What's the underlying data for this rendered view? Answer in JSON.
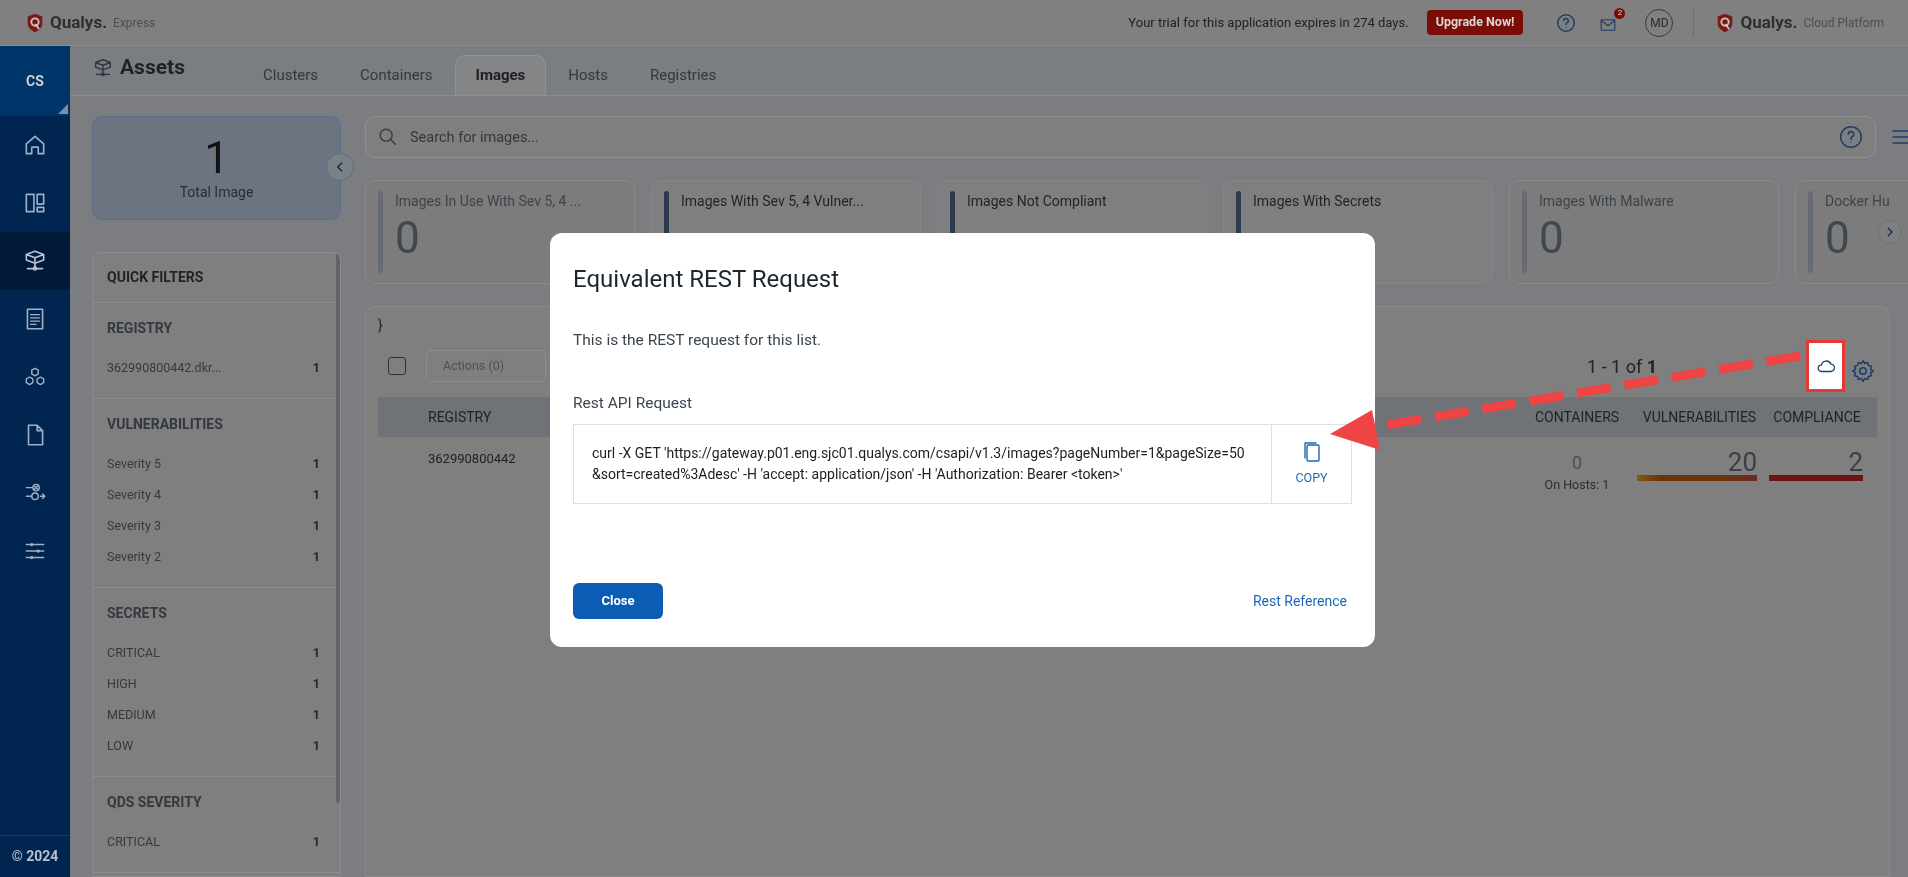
{
  "header": {
    "brand": "Qualys.",
    "product": "Express",
    "trial_notice": "Your trial for this application expires in 274 days.",
    "upgrade_button": "Upgrade Now!",
    "mail_badge": "2",
    "user_initials": "MD",
    "platform_brand": "Qualys.",
    "platform_product": "Cloud Platform"
  },
  "sidebar": {
    "account": "CS",
    "items": [
      {
        "kind": "home",
        "selected": false
      },
      {
        "kind": "dashboard",
        "selected": false
      },
      {
        "kind": "assets",
        "selected": true
      },
      {
        "kind": "report",
        "selected": false
      },
      {
        "kind": "components",
        "selected": false
      },
      {
        "kind": "file",
        "selected": false
      },
      {
        "kind": "policy",
        "selected": false
      },
      {
        "kind": "settings",
        "selected": false
      }
    ],
    "footer": "© 2024"
  },
  "page": {
    "title": "Assets",
    "tabs": [
      {
        "label": "Clusters",
        "selected": false
      },
      {
        "label": "Containers",
        "selected": false
      },
      {
        "label": "Images",
        "selected": true
      },
      {
        "label": "Hosts",
        "selected": false
      },
      {
        "label": "Registries",
        "selected": false
      }
    ]
  },
  "summary": {
    "value": "1",
    "label": "Total Image"
  },
  "search": {
    "placeholder": "Search for images..."
  },
  "stat_cards": [
    {
      "label": "Images In Use With Sev 5, 4 ...",
      "value": "0",
      "disabled": true
    },
    {
      "label": "Images With Sev 5, 4 Vulner...",
      "disabled": false
    },
    {
      "label": "Images Not Compliant",
      "disabled": false
    },
    {
      "label": "Images With Secrets",
      "disabled": false
    },
    {
      "label": "Images With Malware",
      "value": "0",
      "disabled": true
    },
    {
      "label": "Docker Hu",
      "value": "0",
      "disabled": true
    }
  ],
  "quick_filters": {
    "title": "QUICK FILTERS",
    "groups": [
      {
        "title": "REGISTRY",
        "items": [
          {
            "label": "362990800442.dkr...",
            "count": "1"
          }
        ]
      },
      {
        "title": "VULNERABILITIES",
        "items": [
          {
            "label": "Severity 5",
            "count": "1"
          },
          {
            "label": "Severity 4",
            "count": "1"
          },
          {
            "label": "Severity 3",
            "count": "1"
          },
          {
            "label": "Severity 2",
            "count": "1"
          }
        ]
      },
      {
        "title": "SECRETS",
        "items": [
          {
            "label": "CRITICAL",
            "count": "1"
          },
          {
            "label": "HIGH",
            "count": "1"
          },
          {
            "label": "MEDIUM",
            "count": "1"
          },
          {
            "label": "LOW",
            "count": "1"
          }
        ]
      },
      {
        "title": "QDS SEVERITY",
        "items": [
          {
            "label": "CRITICAL",
            "count": "1"
          }
        ]
      }
    ]
  },
  "table": {
    "stray_text": "}",
    "select_all_checked": false,
    "actions": "Actions (0)",
    "pagination": "1 - 1 of **1**",
    "columns": [
      "REGISTRY",
      "CONTAINERS",
      "VULNERABILITIES",
      "COMPLIANCE"
    ],
    "row": {
      "registry": "362990800442",
      "containers": "0",
      "hosts": "On Hosts: 1",
      "vulnerabilities": "20",
      "compliance": "2"
    }
  },
  "dialog": {
    "title": "Equivalent REST Request",
    "description": "This is the REST request for this list.",
    "field_label": "Rest API Request",
    "request": "curl -X GET 'https://gateway.p01.eng.sjc01.qualys.com/csapi/v1.3/images?pageNumber=1&pageSize=50&sort=created%3Adesc' -H 'accept: application/json' -H 'Authorization: Bearer <token>'",
    "copy_button": "COPY",
    "close_button": "Close",
    "reference_link": "Rest Reference"
  }
}
